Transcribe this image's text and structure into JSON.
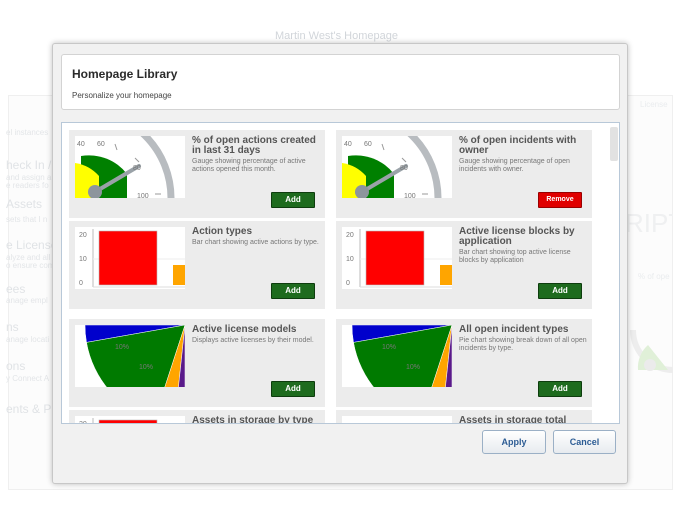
{
  "background": {
    "page_title": "Martin West's Homepage",
    "left_fragments": [
      {
        "text": "el instances",
        "heading": false
      },
      {
        "text": "heck In /",
        "heading": true
      },
      {
        "text": "and assign a",
        "heading": false
      },
      {
        "text": "e readers fo",
        "heading": false
      },
      {
        "text": "Assets",
        "heading": true
      },
      {
        "text": "sets that I n",
        "heading": false
      },
      {
        "text": "e License",
        "heading": true
      },
      {
        "text": "alyze and all",
        "heading": false
      },
      {
        "text": "o ensure com",
        "heading": false
      },
      {
        "text": "ees",
        "heading": true
      },
      {
        "text": "anage empl",
        "heading": false
      },
      {
        "text": "ns",
        "heading": true
      },
      {
        "text": "anage locati",
        "heading": false
      },
      {
        "text": "ons",
        "heading": true
      },
      {
        "text": "y Connect A",
        "heading": false
      },
      {
        "text": "ents & Pr",
        "heading": true
      }
    ],
    "right_license_label": "License",
    "right_big_text": "RIPT",
    "right_gauge_label": "% of ope",
    "right_tick_labels": [
      "40",
      "60"
    ]
  },
  "dialog": {
    "title": "Homepage Library",
    "subtitle": "Personalize your homepage",
    "apply_label": "Apply",
    "cancel_label": "Cancel"
  },
  "widgets": [
    {
      "title": "% of open actions created in last 31 days",
      "description": "Gauge showing percentage of active actions opened this month.",
      "thumbnail": "gauge",
      "action": "Add",
      "ticks": [
        "40",
        "60",
        "80",
        "100"
      ]
    },
    {
      "title": "% of open incidents with owner",
      "description": "Gauge showing percentage of open incidents with owner.",
      "thumbnail": "gauge",
      "action": "Remove",
      "ticks": [
        "40",
        "60",
        "80",
        "100"
      ]
    },
    {
      "title": "Action types",
      "description": "Bar chart showing active actions by type.",
      "thumbnail": "bar",
      "action": "Add",
      "ticks": [
        "20",
        "10",
        "0"
      ]
    },
    {
      "title": "Active license blocks by application",
      "description": "Bar chart showing top active license blocks by application",
      "thumbnail": "bar",
      "action": "Add",
      "ticks": [
        "20",
        "10",
        "0"
      ]
    },
    {
      "title": "Active license models",
      "description": "Displays active licenses by their model.",
      "thumbnail": "pie",
      "action": "Add",
      "slice_labels": [
        "10%",
        "10%"
      ]
    },
    {
      "title": "All open incident types",
      "description": "Pie chart showing break down of all open incidents by type.",
      "thumbnail": "pie",
      "action": "Add",
      "slice_labels": [
        "10%",
        "10%"
      ]
    },
    {
      "title": "Assets in storage by type",
      "description": "",
      "thumbnail": "bar",
      "action": "",
      "ticks": [
        "20"
      ]
    },
    {
      "title": "Assets in storage total",
      "description": "",
      "thumbnail": "blank",
      "action": "",
      "ticks": []
    }
  ],
  "colors": {
    "add_button": "#1e6b1e",
    "remove_button": "#e00000",
    "gauge_green": "#008000",
    "gauge_yellow": "#ffff00",
    "bar_red": "#ff0000",
    "bar_orange": "#ffa500",
    "pie_blue": "#0000cc",
    "pie_green": "#007a00",
    "pie_orange": "#ffa500",
    "pie_purple": "#5a1a8a"
  }
}
